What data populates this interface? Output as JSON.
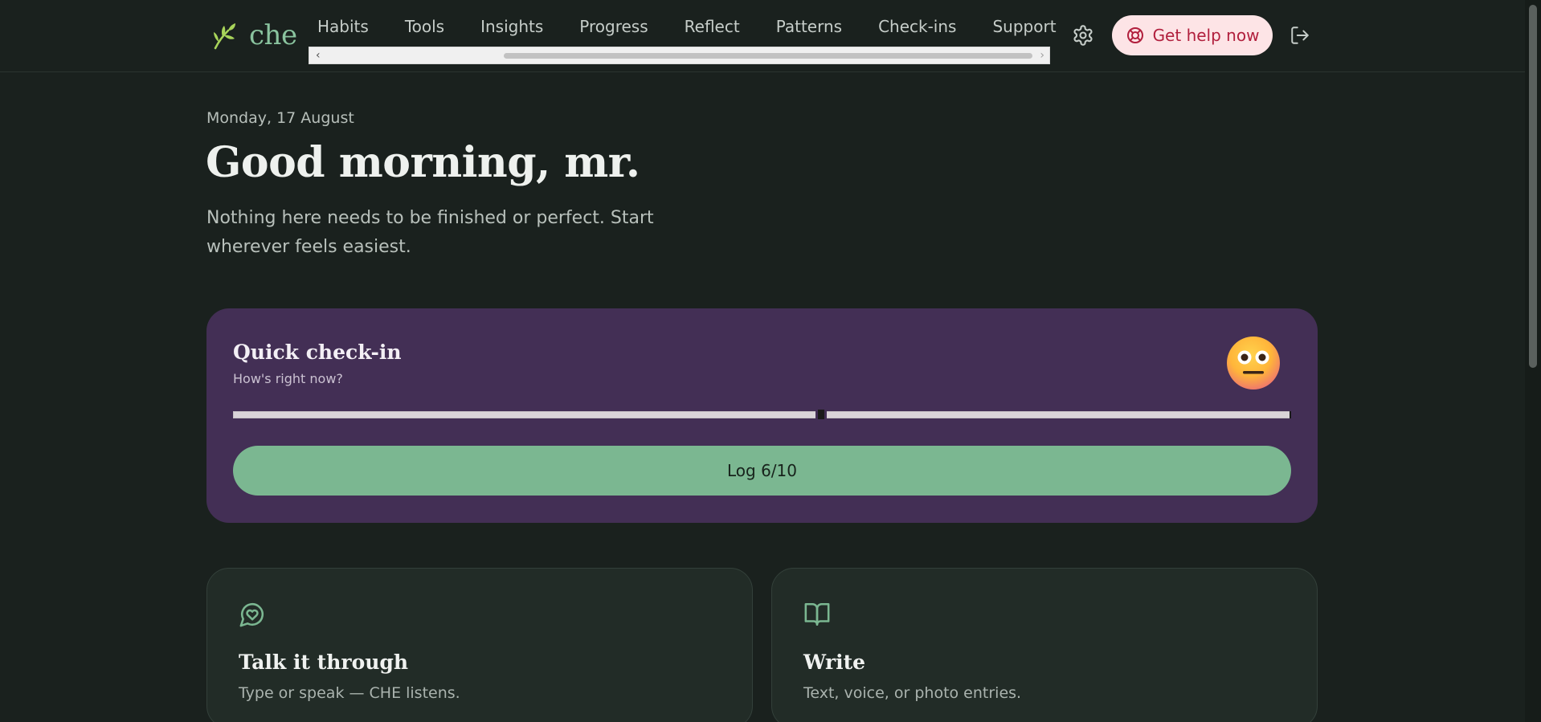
{
  "app": {
    "logo_text": "che"
  },
  "nav": {
    "items": [
      "Habits",
      "Tools",
      "Insights",
      "Progress",
      "Reflect",
      "Patterns",
      "Check-ins",
      "Support"
    ]
  },
  "header": {
    "help_label": "Get help now"
  },
  "icons": {
    "logo": "leaf-icon",
    "settings": "gear-icon",
    "help": "lifebuoy-icon",
    "logout": "logout-icon",
    "talk": "chat-heart-icon",
    "write": "book-open-icon",
    "mood": "neutral-face-emoji"
  },
  "main": {
    "date": "Monday, 17 August",
    "greeting": "Good morning, mr.",
    "subtitle": "Nothing here needs to be finished or perfect. Start wherever feels easiest."
  },
  "checkin": {
    "title": "Quick check-in",
    "subtitle": "How's right now?",
    "slider_value": 6,
    "slider_max": 10,
    "log_label": "Log 6/10"
  },
  "cards": [
    {
      "title": "Talk it through",
      "description": "Type or speak — CHE listens."
    },
    {
      "title": "Write",
      "description": "Text, voice, or photo entries."
    }
  ],
  "colors": {
    "background": "#1a211e",
    "accent_green": "#7bb791",
    "checkin_purple": "#432f55",
    "help_bg": "#fde4e6",
    "help_text": "#b11f3d"
  }
}
